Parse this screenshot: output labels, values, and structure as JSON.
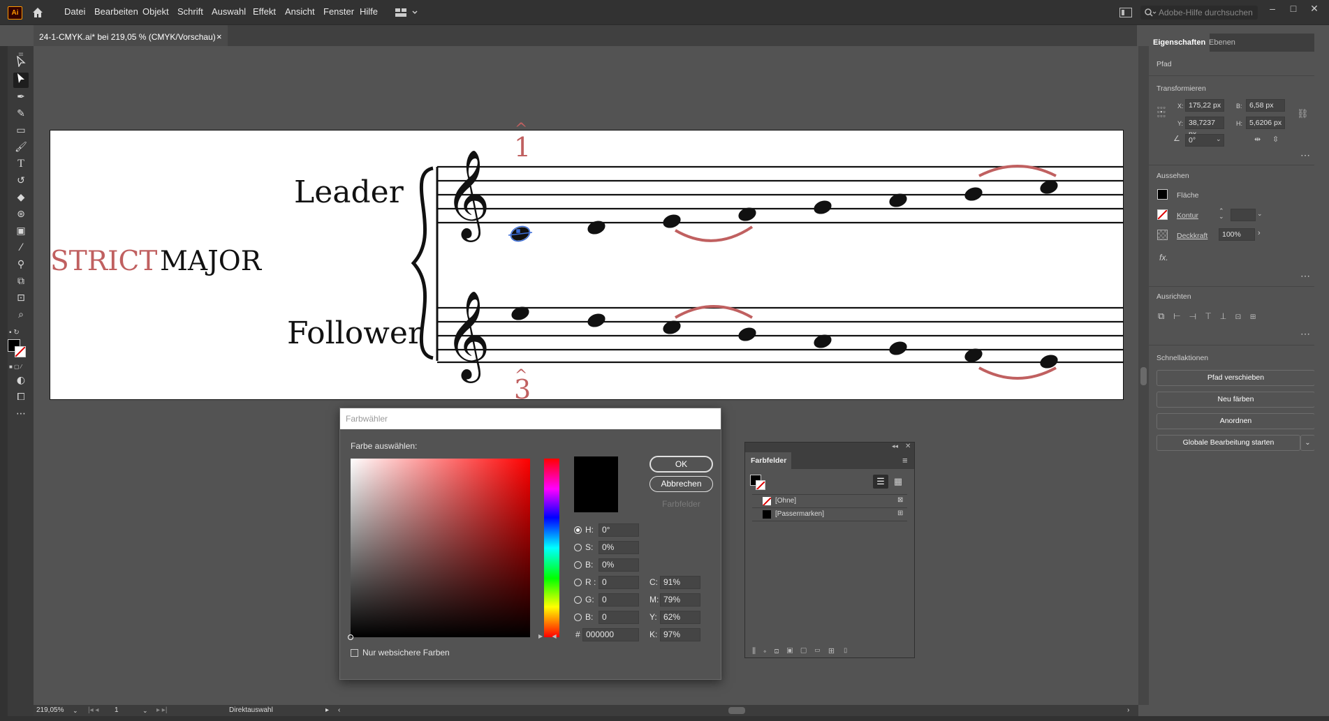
{
  "app": {
    "logo_text": "Ai"
  },
  "menu": [
    "Datei",
    "Bearbeiten",
    "Objekt",
    "Schrift",
    "Auswahl",
    "Effekt",
    "Ansicht",
    "Fenster",
    "Hilfe"
  ],
  "search": {
    "placeholder": "Adobe-Hilfe durchsuchen"
  },
  "document_tab": {
    "title": "24-1-CMYK.ai* bei 219,05 % (CMYK/Vorschau)",
    "close": "×"
  },
  "artboard": {
    "title_red": "STRICT",
    "title_black": "MAJOR",
    "leader": "Leader",
    "follower": "Follower",
    "degree_top": "1",
    "degree_bottom": "3",
    "caret": "^",
    "accent_color": "#c06060"
  },
  "color_picker": {
    "title": "Farbwähler",
    "select_label": "Farbe auswählen:",
    "ok": "OK",
    "cancel": "Abbrechen",
    "swatches_btn": "Farbfelder",
    "fields": [
      {
        "label": "H:",
        "value": "0°"
      },
      {
        "label": "S:",
        "value": "0%"
      },
      {
        "label": "B:",
        "value": "0%"
      },
      {
        "label": "R :",
        "value": "0"
      },
      {
        "label": "G:",
        "value": "0"
      },
      {
        "label": "B:",
        "value": "0"
      }
    ],
    "hex_label": "#",
    "hex": "000000",
    "cmyk": [
      {
        "label": "C:",
        "value": "91%"
      },
      {
        "label": "M:",
        "value": "79%"
      },
      {
        "label": "Y:",
        "value": "62%"
      },
      {
        "label": "K:",
        "value": "97%"
      }
    ],
    "websafe": "Nur websichere Farben"
  },
  "swatches_panel": {
    "title": "Farbfelder",
    "items": [
      "[Ohne]",
      "[Passermarken]"
    ]
  },
  "properties": {
    "tabs": [
      "Eigenschaften",
      "Ebenen"
    ],
    "object_type": "Pfad",
    "transform": {
      "title": "Transformieren",
      "x_label": "X:",
      "x": "175,22 px",
      "y_label": "Y:",
      "y": "38,7237 px",
      "w_label": "B:",
      "w": "6,58 px",
      "h_label": "H:",
      "h": "5,6206 px",
      "angle": "0°"
    },
    "appearance": {
      "title": "Aussehen",
      "fill": "Fläche",
      "stroke": "Kontur",
      "opacity_label": "Deckkraft",
      "opacity": "100%",
      "fx": "fx."
    },
    "align": {
      "title": "Ausrichten"
    },
    "quick_actions": {
      "title": "Schnellaktionen",
      "buttons": [
        "Pfad verschieben",
        "Neu färben",
        "Anordnen",
        "Globale Bearbeitung starten"
      ]
    }
  },
  "status": {
    "zoom": "219,05%",
    "artboard": "1",
    "tool": "Direktauswahl"
  }
}
